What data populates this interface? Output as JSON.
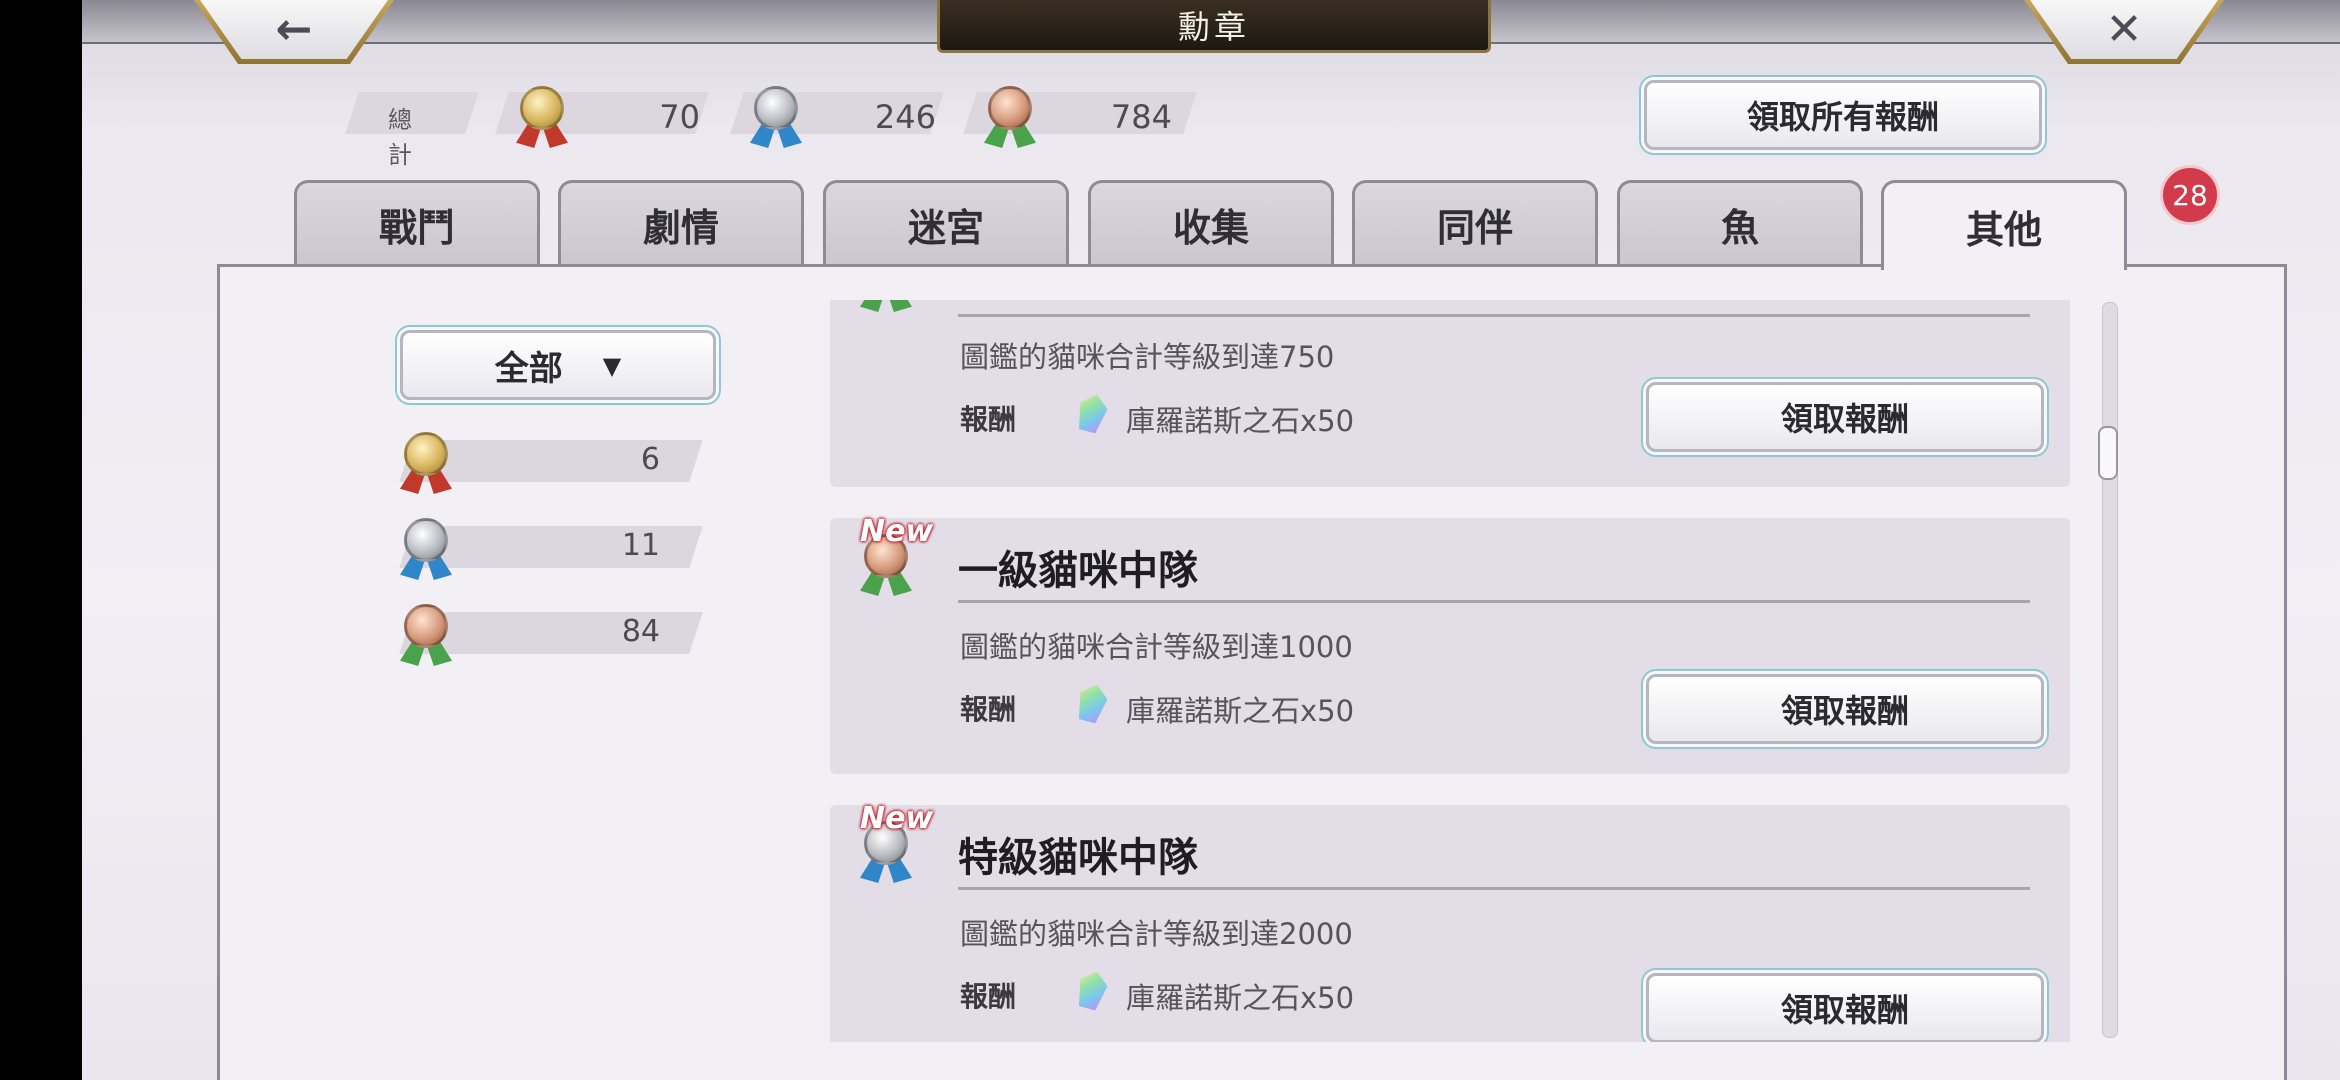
{
  "header": {
    "title": "勳章",
    "back_icon": "←",
    "close_icon": "✕"
  },
  "totals": {
    "label": "總計",
    "gold": "70",
    "silver": "246",
    "bronze": "784"
  },
  "claim_all_label": "領取所有報酬",
  "tabs": [
    {
      "label": "戰鬥"
    },
    {
      "label": "劇情"
    },
    {
      "label": "迷宮"
    },
    {
      "label": "收集"
    },
    {
      "label": "同伴"
    },
    {
      "label": "魚"
    },
    {
      "label": "其他"
    }
  ],
  "active_tab": "其他",
  "tab_badge": "28",
  "filter": {
    "selected": "全部",
    "caret": "▼"
  },
  "counts": {
    "gold": "6",
    "silver": "11",
    "bronze": "84"
  },
  "achievements": [
    {
      "title": "",
      "desc": "圖鑑的貓咪合計等級到達750",
      "reward_label": "報酬",
      "reward": "庫羅諾斯之石x50",
      "button": "領取報酬",
      "medal": "bronze",
      "new": ""
    },
    {
      "title": "一級貓咪中隊",
      "desc": "圖鑑的貓咪合計等級到達1000",
      "reward_label": "報酬",
      "reward": "庫羅諾斯之石x50",
      "button": "領取報酬",
      "medal": "bronze",
      "new": "New"
    },
    {
      "title": "特級貓咪中隊",
      "desc": "圖鑑的貓咪合計等級到達2000",
      "reward_label": "報酬",
      "reward": "庫羅諾斯之石x50",
      "button": "領取報酬",
      "medal": "silver",
      "new": "New"
    }
  ],
  "colors": {
    "badge": "#d23b4b",
    "panel": "#f2f0f5",
    "card": "#e3dde7"
  }
}
